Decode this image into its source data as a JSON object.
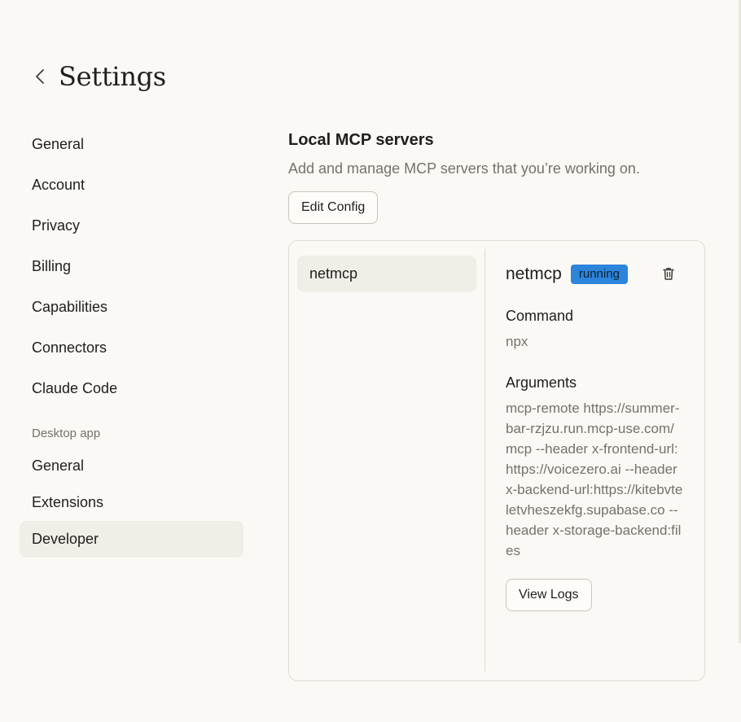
{
  "header": {
    "title": "Settings"
  },
  "sidebar": {
    "items": [
      {
        "label": "General"
      },
      {
        "label": "Account"
      },
      {
        "label": "Privacy"
      },
      {
        "label": "Billing"
      },
      {
        "label": "Capabilities"
      },
      {
        "label": "Connectors"
      },
      {
        "label": "Claude Code"
      }
    ],
    "section_label": "Desktop app",
    "desktop_items": [
      {
        "label": "General"
      },
      {
        "label": "Extensions"
      },
      {
        "label": "Developer",
        "active": true
      }
    ]
  },
  "main": {
    "title": "Local MCP servers",
    "subtitle": "Add and manage MCP servers that you’re working on.",
    "edit_config_label": "Edit Config",
    "servers": [
      {
        "name": "netmcp"
      }
    ],
    "detail": {
      "name": "netmcp",
      "status": "running",
      "command_label": "Command",
      "command_value": "npx",
      "arguments_label": "Arguments",
      "arguments_value": "mcp-remote https://summer-bar-rzjzu.run.mcp-use.com/mcp --header x-frontend-url:https://voicezero.ai --header x-backend-url:https://kitebvteletvheszekfg.supabase.co --header x-storage-backend:files",
      "view_logs_label": "View Logs"
    }
  },
  "colors": {
    "background": "#faf9f5",
    "active_item": "#f0eee6",
    "status_badge": "#2c84db",
    "muted_text": "#73726c"
  },
  "icons": {
    "back": "chevron-left-icon",
    "delete": "trash-icon"
  }
}
